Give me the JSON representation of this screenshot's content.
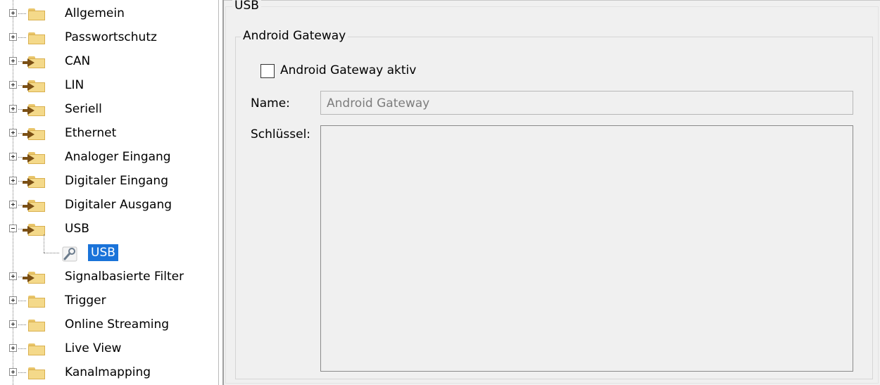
{
  "tree": {
    "items": [
      {
        "label": "Allgemein",
        "icon": "folder-icon",
        "expander": "plus"
      },
      {
        "label": "Passwortschutz",
        "icon": "folder-icon",
        "expander": "plus"
      },
      {
        "label": "CAN",
        "icon": "folder-arrow-icon",
        "expander": "plus"
      },
      {
        "label": "LIN",
        "icon": "folder-arrow-icon",
        "expander": "plus"
      },
      {
        "label": "Seriell",
        "icon": "folder-arrow-icon",
        "expander": "plus"
      },
      {
        "label": "Ethernet",
        "icon": "folder-arrow-icon",
        "expander": "plus"
      },
      {
        "label": "Analoger Eingang",
        "icon": "folder-arrow-icon",
        "expander": "plus"
      },
      {
        "label": "Digitaler Eingang",
        "icon": "folder-arrow-icon",
        "expander": "plus"
      },
      {
        "label": "Digitaler Ausgang",
        "icon": "folder-arrow-icon",
        "expander": "plus"
      },
      {
        "label": "USB",
        "icon": "folder-arrow-icon",
        "expander": "minus"
      },
      {
        "label": "USB",
        "icon": "wrench-icon",
        "child": true,
        "selected": true
      },
      {
        "label": "Signalbasierte Filter",
        "icon": "folder-arrow-icon",
        "expander": "plus"
      },
      {
        "label": "Trigger",
        "icon": "folder-icon",
        "expander": "plus"
      },
      {
        "label": "Online Streaming",
        "icon": "folder-icon",
        "expander": "plus"
      },
      {
        "label": "Live View",
        "icon": "folder-icon",
        "expander": "plus"
      },
      {
        "label": "Kanalmapping",
        "icon": "folder-icon",
        "expander": "plus"
      }
    ]
  },
  "panel": {
    "section_title": "USB",
    "group_title": "Android Gateway",
    "checkbox_label": "Android Gateway aktiv",
    "checkbox_checked": false,
    "name_label": "Name:",
    "name_value": "Android Gateway",
    "key_label": "Schlüssel:",
    "key_value": ""
  },
  "colors": {
    "selection": "#1a73d9",
    "panel_bg": "#f0f0f0"
  }
}
